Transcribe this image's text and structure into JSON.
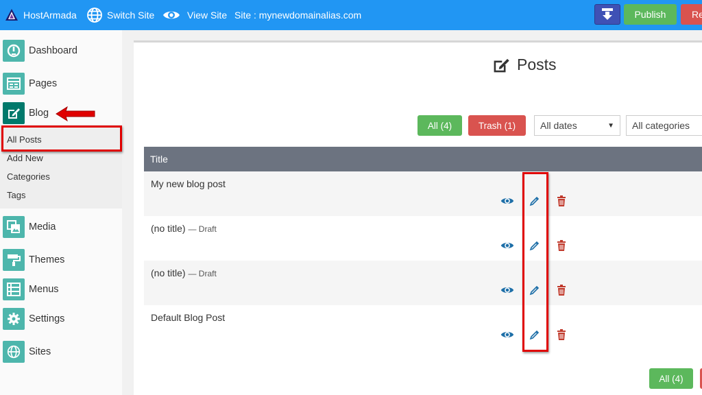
{
  "topbar": {
    "brand": "HostArmada",
    "switch_site": "Switch Site",
    "view_site": "View Site",
    "site_label": "Site : mynewdomainalias.com",
    "publish": "Publish",
    "cut_button": "Re",
    "colors": {
      "bar": "#2196f3",
      "publish": "#5cb85c",
      "red": "#d9534f",
      "download": "#3f51b5"
    }
  },
  "sidebar": {
    "items": [
      {
        "label": "Dashboard",
        "icon": "dashboard-icon"
      },
      {
        "label": "Pages",
        "icon": "pages-icon"
      },
      {
        "label": "Blog",
        "icon": "blog-edit-icon"
      },
      {
        "label": "Media",
        "icon": "media-icon"
      },
      {
        "label": "Themes",
        "icon": "paint-roller-icon"
      },
      {
        "label": "Menus",
        "icon": "menu-list-icon"
      },
      {
        "label": "Settings",
        "icon": "gear-icon"
      },
      {
        "label": "Sites",
        "icon": "globe-icon"
      }
    ],
    "blog_submenu": [
      "All Posts",
      "Add New",
      "Categories",
      "Tags"
    ]
  },
  "main": {
    "title": "Posts",
    "filters": {
      "all": "All (4)",
      "trash": "Trash (1)",
      "dates": "All dates",
      "categories": "All categories"
    },
    "table": {
      "column_title": "Title",
      "rows": [
        {
          "title": "My new blog post",
          "status": ""
        },
        {
          "title": "(no title)",
          "status": "— Draft"
        },
        {
          "title": "(no title)",
          "status": "— Draft"
        },
        {
          "title": "Default Blog Post",
          "status": ""
        }
      ]
    },
    "bottom_all": "All (4)"
  }
}
